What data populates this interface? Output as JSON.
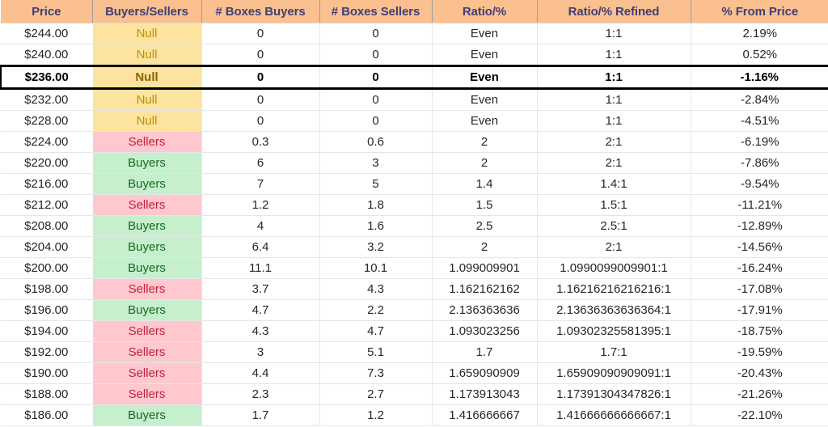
{
  "table": {
    "name": "price-ladder-buyers-sellers-table",
    "columns": [
      {
        "key": "price",
        "label": "Price"
      },
      {
        "key": "buyers_sellers",
        "label": "Buyers/Sellers"
      },
      {
        "key": "boxes_buyers",
        "label": "# Boxes Buyers"
      },
      {
        "key": "boxes_sellers",
        "label": "# Boxes Sellers"
      },
      {
        "key": "ratio_pct",
        "label": "Ratio/%"
      },
      {
        "key": "ratio_refined",
        "label": "Ratio/% Refined"
      },
      {
        "key": "pct_from_price",
        "label": "% From Price"
      }
    ],
    "colors": {
      "header_bg": "#FAC090",
      "header_text": "#3F3F76",
      "null_bg": "#FCE4A0",
      "null_text": "#BF8F00",
      "sellers_bg": "#FFC7CE",
      "sellers_text": "#C0223B",
      "buyers_bg": "#C6EFCE",
      "buyers_text": "#17691F",
      "highlight_border": "#000000",
      "grid_line": "#E6E6E6"
    },
    "highlighted_row_index": 2,
    "rows": [
      {
        "price": "$244.00",
        "buyers_sellers": "Null",
        "state": "null",
        "boxes_buyers": "0",
        "boxes_sellers": "0",
        "ratio_pct": "Even",
        "ratio_refined": "1:1",
        "pct_from_price": "2.19%"
      },
      {
        "price": "$240.00",
        "buyers_sellers": "Null",
        "state": "null",
        "boxes_buyers": "0",
        "boxes_sellers": "0",
        "ratio_pct": "Even",
        "ratio_refined": "1:1",
        "pct_from_price": "0.52%"
      },
      {
        "price": "$236.00",
        "buyers_sellers": "Null",
        "state": "null",
        "boxes_buyers": "0",
        "boxes_sellers": "0",
        "ratio_pct": "Even",
        "ratio_refined": "1:1",
        "pct_from_price": "-1.16%"
      },
      {
        "price": "$232.00",
        "buyers_sellers": "Null",
        "state": "null",
        "boxes_buyers": "0",
        "boxes_sellers": "0",
        "ratio_pct": "Even",
        "ratio_refined": "1:1",
        "pct_from_price": "-2.84%"
      },
      {
        "price": "$228.00",
        "buyers_sellers": "Null",
        "state": "null",
        "boxes_buyers": "0",
        "boxes_sellers": "0",
        "ratio_pct": "Even",
        "ratio_refined": "1:1",
        "pct_from_price": "-4.51%"
      },
      {
        "price": "$224.00",
        "buyers_sellers": "Sellers",
        "state": "sellers",
        "boxes_buyers": "0.3",
        "boxes_sellers": "0.6",
        "ratio_pct": "2",
        "ratio_refined": "2:1",
        "pct_from_price": "-6.19%"
      },
      {
        "price": "$220.00",
        "buyers_sellers": "Buyers",
        "state": "buyers",
        "boxes_buyers": "6",
        "boxes_sellers": "3",
        "ratio_pct": "2",
        "ratio_refined": "2:1",
        "pct_from_price": "-7.86%"
      },
      {
        "price": "$216.00",
        "buyers_sellers": "Buyers",
        "state": "buyers",
        "boxes_buyers": "7",
        "boxes_sellers": "5",
        "ratio_pct": "1.4",
        "ratio_refined": "1.4:1",
        "pct_from_price": "-9.54%"
      },
      {
        "price": "$212.00",
        "buyers_sellers": "Sellers",
        "state": "sellers",
        "boxes_buyers": "1.2",
        "boxes_sellers": "1.8",
        "ratio_pct": "1.5",
        "ratio_refined": "1.5:1",
        "pct_from_price": "-11.21%"
      },
      {
        "price": "$208.00",
        "buyers_sellers": "Buyers",
        "state": "buyers",
        "boxes_buyers": "4",
        "boxes_sellers": "1.6",
        "ratio_pct": "2.5",
        "ratio_refined": "2.5:1",
        "pct_from_price": "-12.89%"
      },
      {
        "price": "$204.00",
        "buyers_sellers": "Buyers",
        "state": "buyers",
        "boxes_buyers": "6.4",
        "boxes_sellers": "3.2",
        "ratio_pct": "2",
        "ratio_refined": "2:1",
        "pct_from_price": "-14.56%"
      },
      {
        "price": "$200.00",
        "buyers_sellers": "Buyers",
        "state": "buyers",
        "boxes_buyers": "11.1",
        "boxes_sellers": "10.1",
        "ratio_pct": "1.099009901",
        "ratio_refined": "1.0990099009901:1",
        "pct_from_price": "-16.24%"
      },
      {
        "price": "$198.00",
        "buyers_sellers": "Sellers",
        "state": "sellers",
        "boxes_buyers": "3.7",
        "boxes_sellers": "4.3",
        "ratio_pct": "1.162162162",
        "ratio_refined": "1.16216216216216:1",
        "pct_from_price": "-17.08%"
      },
      {
        "price": "$196.00",
        "buyers_sellers": "Buyers",
        "state": "buyers",
        "boxes_buyers": "4.7",
        "boxes_sellers": "2.2",
        "ratio_pct": "2.136363636",
        "ratio_refined": "2.13636363636364:1",
        "pct_from_price": "-17.91%"
      },
      {
        "price": "$194.00",
        "buyers_sellers": "Sellers",
        "state": "sellers",
        "boxes_buyers": "4.3",
        "boxes_sellers": "4.7",
        "ratio_pct": "1.093023256",
        "ratio_refined": "1.09302325581395:1",
        "pct_from_price": "-18.75%"
      },
      {
        "price": "$192.00",
        "buyers_sellers": "Sellers",
        "state": "sellers",
        "boxes_buyers": "3",
        "boxes_sellers": "5.1",
        "ratio_pct": "1.7",
        "ratio_refined": "1.7:1",
        "pct_from_price": "-19.59%"
      },
      {
        "price": "$190.00",
        "buyers_sellers": "Sellers",
        "state": "sellers",
        "boxes_buyers": "4.4",
        "boxes_sellers": "7.3",
        "ratio_pct": "1.659090909",
        "ratio_refined": "1.65909090909091:1",
        "pct_from_price": "-20.43%"
      },
      {
        "price": "$188.00",
        "buyers_sellers": "Sellers",
        "state": "sellers",
        "boxes_buyers": "2.3",
        "boxes_sellers": "2.7",
        "ratio_pct": "1.173913043",
        "ratio_refined": "1.17391304347826:1",
        "pct_from_price": "-21.26%"
      },
      {
        "price": "$186.00",
        "buyers_sellers": "Buyers",
        "state": "buyers",
        "boxes_buyers": "1.7",
        "boxes_sellers": "1.2",
        "ratio_pct": "1.416666667",
        "ratio_refined": "1.41666666666667:1",
        "pct_from_price": "-22.10%"
      }
    ]
  }
}
